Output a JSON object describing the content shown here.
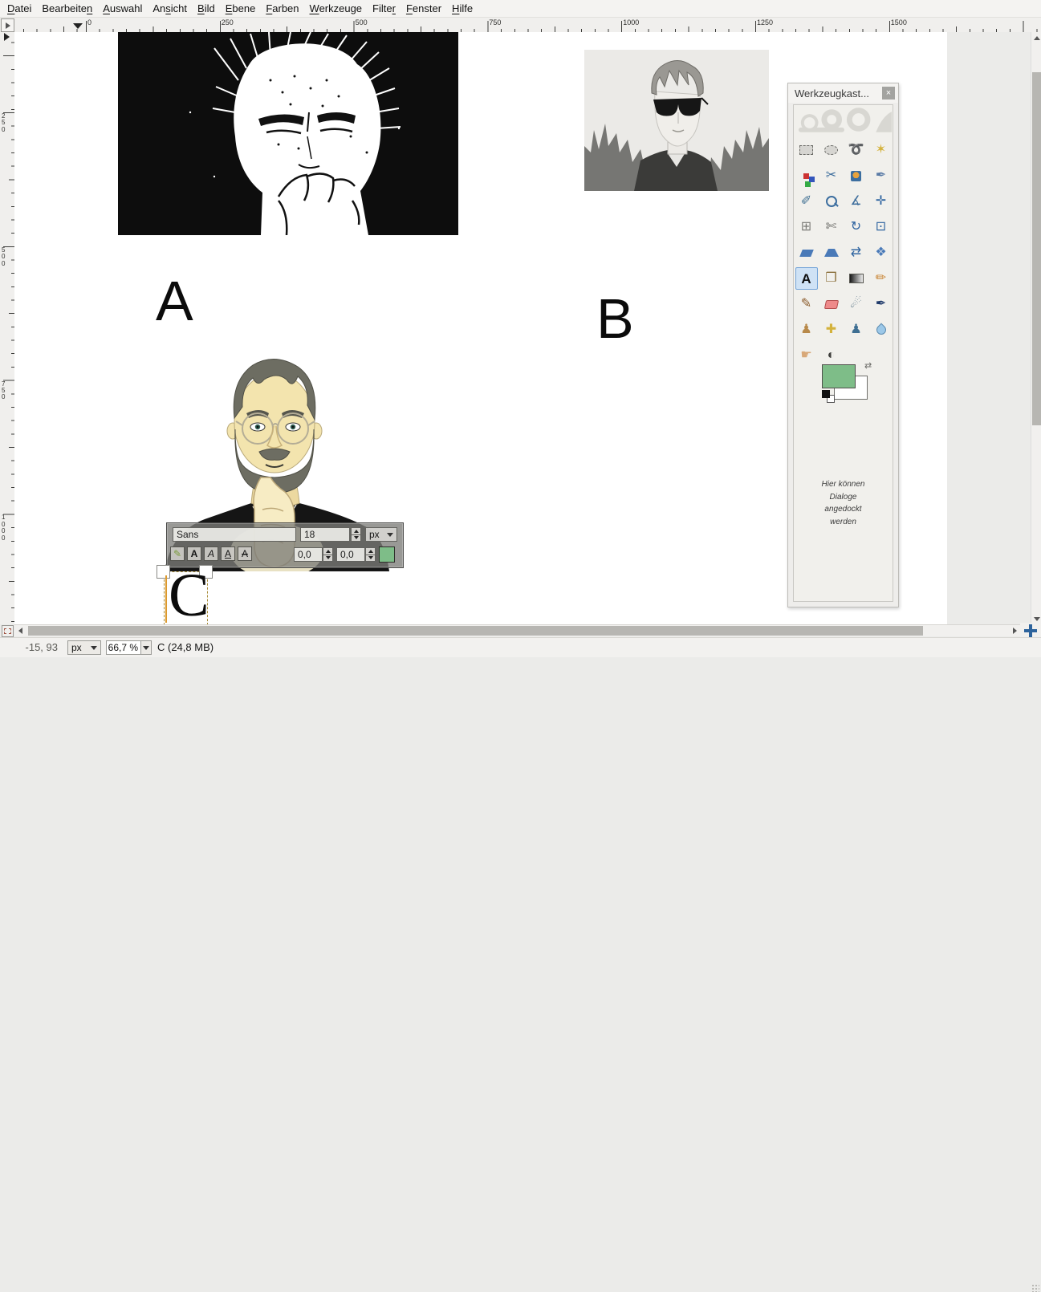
{
  "menu_bar": {
    "items": [
      {
        "label": "Datei",
        "mnemonic_index": 0
      },
      {
        "label": "Bearbeiten",
        "mnemonic_index": 9
      },
      {
        "label": "Auswahl",
        "mnemonic_index": 0
      },
      {
        "label": "Ansicht",
        "mnemonic_index": 2
      },
      {
        "label": "Bild",
        "mnemonic_index": 0
      },
      {
        "label": "Ebene",
        "mnemonic_index": 0
      },
      {
        "label": "Farben",
        "mnemonic_index": 0
      },
      {
        "label": "Werkzeuge",
        "mnemonic_index": 0
      },
      {
        "label": "Filter",
        "mnemonic_index": 5
      },
      {
        "label": "Fenster",
        "mnemonic_index": 0
      },
      {
        "label": "Hilfe",
        "mnemonic_index": 0
      }
    ]
  },
  "rulers": {
    "horizontal_labels": [
      "0",
      "250",
      "500",
      "750",
      "1000",
      "1250",
      "1500"
    ],
    "vertical_labels": [
      "250",
      "500",
      "750",
      "1000"
    ]
  },
  "canvas": {
    "label_a": "A",
    "label_b": "B",
    "images": [
      {
        "name": "image-a",
        "description": "black-and-white threshold portrait of a man with hand on chin"
      },
      {
        "name": "image-b",
        "description": "grayscale pencil-sketch portrait of a young man wearing sunglasses"
      },
      {
        "name": "image-c",
        "description": "color cartoon illustration of bearded man with round glasses in black turtleneck"
      }
    ],
    "text_layer": {
      "text": "C"
    }
  },
  "text_toolbar": {
    "font_name": "Sans",
    "font_size": "18",
    "unit": "px",
    "baseline": "0,0",
    "kerning": "0,0",
    "color": "#7ebd88",
    "style_buttons": [
      {
        "name": "bold",
        "label": "A"
      },
      {
        "name": "italic",
        "label": "A"
      },
      {
        "name": "underline",
        "label": "A"
      },
      {
        "name": "strikethrough",
        "label": "A"
      }
    ]
  },
  "toolbox": {
    "title": "Werkzeugkast...",
    "close_label": "×",
    "dock_hint": "Hier können Dialoge angedockt werden",
    "foreground_color": "#7ebd88",
    "background_color": "#ffffff",
    "selected_tool": "text",
    "tools": [
      {
        "name": "rectangle-select"
      },
      {
        "name": "ellipse-select"
      },
      {
        "name": "free-select"
      },
      {
        "name": "fuzzy-select"
      },
      {
        "name": "select-by-color"
      },
      {
        "name": "intelligent-scissors"
      },
      {
        "name": "foreground-select"
      },
      {
        "name": "paths"
      },
      {
        "name": "color-picker"
      },
      {
        "name": "zoom"
      },
      {
        "name": "measure"
      },
      {
        "name": "move"
      },
      {
        "name": "alignment"
      },
      {
        "name": "crop"
      },
      {
        "name": "rotate"
      },
      {
        "name": "scale"
      },
      {
        "name": "shear"
      },
      {
        "name": "perspective"
      },
      {
        "name": "flip"
      },
      {
        "name": "handle-transform"
      },
      {
        "name": "text",
        "selected": true
      },
      {
        "name": "bucket-fill"
      },
      {
        "name": "gradient"
      },
      {
        "name": "pencil"
      },
      {
        "name": "paintbrush"
      },
      {
        "name": "eraser"
      },
      {
        "name": "airbrush"
      },
      {
        "name": "ink"
      },
      {
        "name": "clone"
      },
      {
        "name": "heal"
      },
      {
        "name": "perspective-clone"
      },
      {
        "name": "blur-sharpen"
      },
      {
        "name": "smudge"
      },
      {
        "name": "dodge-burn"
      }
    ]
  },
  "status_bar": {
    "cursor_position": "-15, 93",
    "unit": "px",
    "zoom": "66,7 %",
    "message": "C (24,8 MB)"
  }
}
